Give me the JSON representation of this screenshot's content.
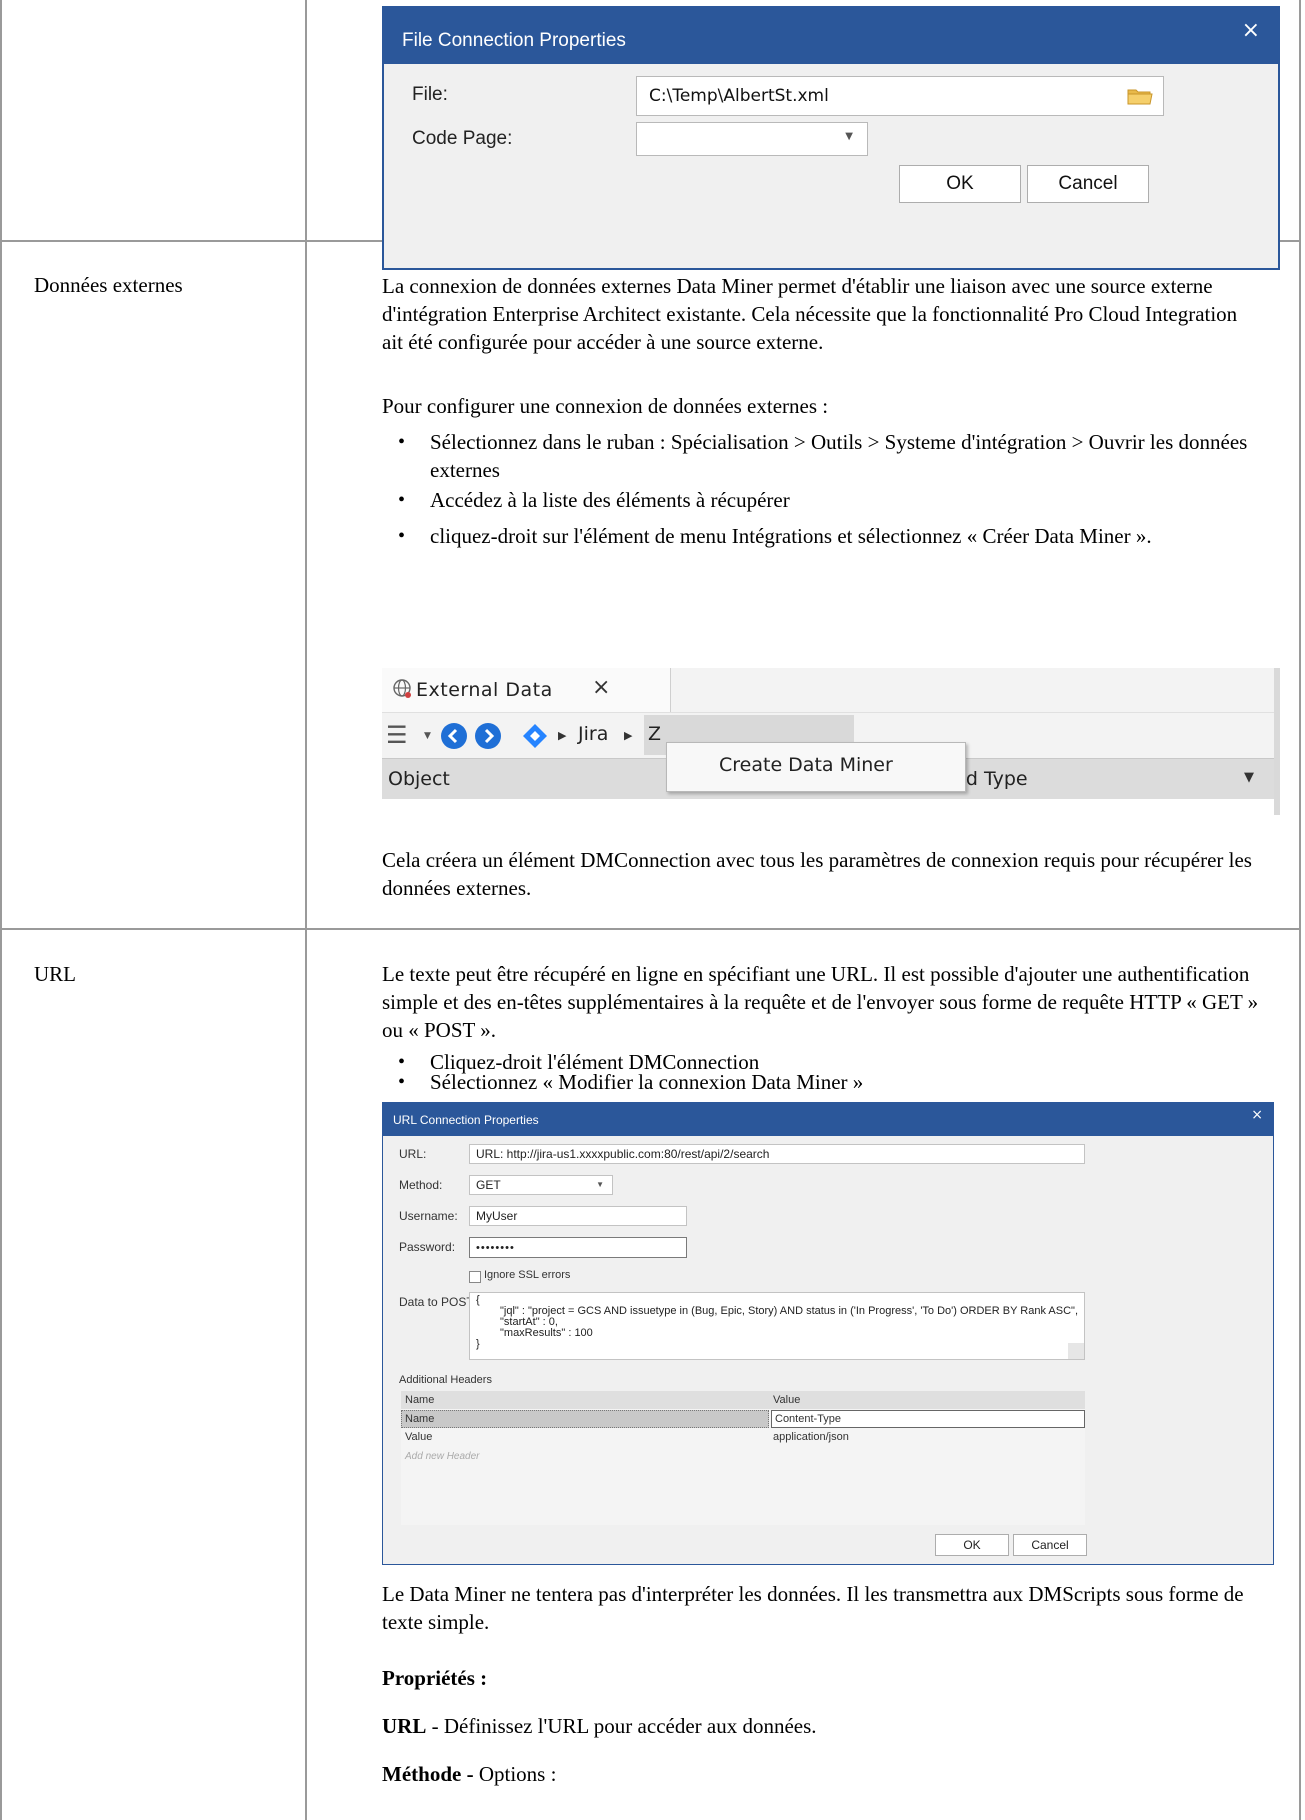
{
  "file_dialog": {
    "title": "File Connection Properties",
    "close": "×",
    "file_label": "File:",
    "file_value": "C:\\Temp\\AlbertSt.xml",
    "codepage_label": "Code Page:",
    "codepage_value": "",
    "ok": "OK",
    "cancel": "Cancel"
  },
  "row_external": {
    "label": "Données externes",
    "p1": "La connexion de données externes Data Miner permet d'établir une liaison avec une source externe d'intégration Enterprise Architect existante. Cela nécessite que la fonctionnalité Pro Cloud Integration ait été configurée pour accéder à une source externe.",
    "p2": "Pour configurer une connexion de données externes :",
    "bullets": [
      "Sélectionnez dans le ruban : Spécialisation > Outils > Systeme d'intégration > Ouvrir les données externes",
      "Accédez à la liste des éléments à récupérer",
      "cliquez-droit sur l'élément de menu Intégrations et sélectionnez « Créer Data Miner »."
    ],
    "p3": "Cela créera un élément DMConnection avec tous les paramètres de connexion requis pour récupérer les données externes."
  },
  "ext_screen": {
    "tab": "External Data",
    "tab_close": "×",
    "crumb1": "Jira",
    "crumb2": "Z",
    "menu_item": "Create Data Miner",
    "col_object": "Object",
    "col_mapped": "Mapped Type"
  },
  "row_url": {
    "label": "URL",
    "p1": "Le texte peut être récupéré en ligne en spécifiant une URL. Il est possible d'ajouter une authentification simple et des en-têtes supplémentaires à la requête et de l'envoyer sous forme de requête HTTP « GET » ou « POST ».",
    "bullets": [
      "Cliquez-droit l'élément DMConnection",
      "Sélectionnez « Modifier la connexion Data Miner »"
    ],
    "p2": "Le Data Miner ne tentera pas d'interpréter les données. Il les transmettra aux DMScripts sous forme de texte simple.",
    "props_heading": "Propriétés :",
    "url_bold": "URL",
    "url_rest": " - Définissez l'URL pour accéder aux données.",
    "method_bold": "Méthode -",
    "method_rest": " Options :"
  },
  "url_dialog": {
    "title": "URL Connection Properties",
    "close": "×",
    "url_label": "URL:",
    "url_value": "URL: http://jira-us1.xxxxpublic.com:80/rest/api/2/search",
    "method_label": "Method:",
    "method_value": "GET",
    "username_label": "Username:",
    "username_value": "MyUser",
    "password_label": "Password:",
    "password_value": "••••••••",
    "ignore_ssl": "Ignore SSL errors",
    "post_label": "Data to POST:",
    "post_lines": [
      "{",
      "\"jql\" : \"project = GCS AND issuetype in (Bug, Epic, Story) AND status in ('In Progress', 'To Do') ORDER BY Rank ASC\",",
      "\"startAt\" : 0,",
      "\"maxResults\" : 100",
      "}"
    ],
    "headers_label": "Additional Headers",
    "col_name": "Name",
    "col_value": "Value",
    "rows": [
      {
        "name": "Name",
        "value": "Content-Type"
      },
      {
        "name": "Value",
        "value": "application/json"
      }
    ],
    "add_new": "Add new Header",
    "ok": "OK",
    "cancel": "Cancel"
  }
}
